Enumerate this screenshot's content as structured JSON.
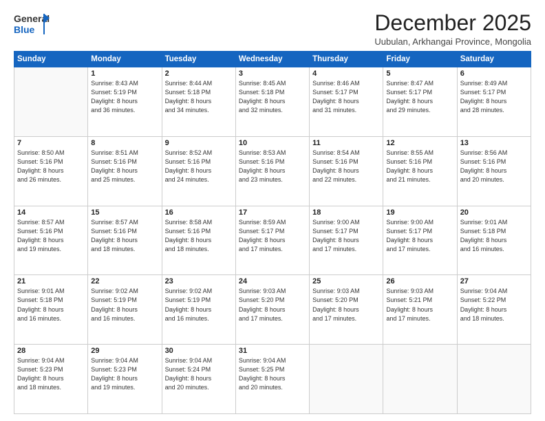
{
  "header": {
    "logo": {
      "line1": "General",
      "line2": "Blue"
    },
    "title": "December 2025",
    "location": "Uubulan, Arkhangai Province, Mongolia"
  },
  "weekdays": [
    "Sunday",
    "Monday",
    "Tuesday",
    "Wednesday",
    "Thursday",
    "Friday",
    "Saturday"
  ],
  "weeks": [
    [
      {
        "day": "",
        "info": ""
      },
      {
        "day": "1",
        "info": "Sunrise: 8:43 AM\nSunset: 5:19 PM\nDaylight: 8 hours\nand 36 minutes."
      },
      {
        "day": "2",
        "info": "Sunrise: 8:44 AM\nSunset: 5:18 PM\nDaylight: 8 hours\nand 34 minutes."
      },
      {
        "day": "3",
        "info": "Sunrise: 8:45 AM\nSunset: 5:18 PM\nDaylight: 8 hours\nand 32 minutes."
      },
      {
        "day": "4",
        "info": "Sunrise: 8:46 AM\nSunset: 5:17 PM\nDaylight: 8 hours\nand 31 minutes."
      },
      {
        "day": "5",
        "info": "Sunrise: 8:47 AM\nSunset: 5:17 PM\nDaylight: 8 hours\nand 29 minutes."
      },
      {
        "day": "6",
        "info": "Sunrise: 8:49 AM\nSunset: 5:17 PM\nDaylight: 8 hours\nand 28 minutes."
      }
    ],
    [
      {
        "day": "7",
        "info": "Sunrise: 8:50 AM\nSunset: 5:16 PM\nDaylight: 8 hours\nand 26 minutes."
      },
      {
        "day": "8",
        "info": "Sunrise: 8:51 AM\nSunset: 5:16 PM\nDaylight: 8 hours\nand 25 minutes."
      },
      {
        "day": "9",
        "info": "Sunrise: 8:52 AM\nSunset: 5:16 PM\nDaylight: 8 hours\nand 24 minutes."
      },
      {
        "day": "10",
        "info": "Sunrise: 8:53 AM\nSunset: 5:16 PM\nDaylight: 8 hours\nand 23 minutes."
      },
      {
        "day": "11",
        "info": "Sunrise: 8:54 AM\nSunset: 5:16 PM\nDaylight: 8 hours\nand 22 minutes."
      },
      {
        "day": "12",
        "info": "Sunrise: 8:55 AM\nSunset: 5:16 PM\nDaylight: 8 hours\nand 21 minutes."
      },
      {
        "day": "13",
        "info": "Sunrise: 8:56 AM\nSunset: 5:16 PM\nDaylight: 8 hours\nand 20 minutes."
      }
    ],
    [
      {
        "day": "14",
        "info": "Sunrise: 8:57 AM\nSunset: 5:16 PM\nDaylight: 8 hours\nand 19 minutes."
      },
      {
        "day": "15",
        "info": "Sunrise: 8:57 AM\nSunset: 5:16 PM\nDaylight: 8 hours\nand 18 minutes."
      },
      {
        "day": "16",
        "info": "Sunrise: 8:58 AM\nSunset: 5:16 PM\nDaylight: 8 hours\nand 18 minutes."
      },
      {
        "day": "17",
        "info": "Sunrise: 8:59 AM\nSunset: 5:17 PM\nDaylight: 8 hours\nand 17 minutes."
      },
      {
        "day": "18",
        "info": "Sunrise: 9:00 AM\nSunset: 5:17 PM\nDaylight: 8 hours\nand 17 minutes."
      },
      {
        "day": "19",
        "info": "Sunrise: 9:00 AM\nSunset: 5:17 PM\nDaylight: 8 hours\nand 17 minutes."
      },
      {
        "day": "20",
        "info": "Sunrise: 9:01 AM\nSunset: 5:18 PM\nDaylight: 8 hours\nand 16 minutes."
      }
    ],
    [
      {
        "day": "21",
        "info": "Sunrise: 9:01 AM\nSunset: 5:18 PM\nDaylight: 8 hours\nand 16 minutes."
      },
      {
        "day": "22",
        "info": "Sunrise: 9:02 AM\nSunset: 5:19 PM\nDaylight: 8 hours\nand 16 minutes."
      },
      {
        "day": "23",
        "info": "Sunrise: 9:02 AM\nSunset: 5:19 PM\nDaylight: 8 hours\nand 16 minutes."
      },
      {
        "day": "24",
        "info": "Sunrise: 9:03 AM\nSunset: 5:20 PM\nDaylight: 8 hours\nand 17 minutes."
      },
      {
        "day": "25",
        "info": "Sunrise: 9:03 AM\nSunset: 5:20 PM\nDaylight: 8 hours\nand 17 minutes."
      },
      {
        "day": "26",
        "info": "Sunrise: 9:03 AM\nSunset: 5:21 PM\nDaylight: 8 hours\nand 17 minutes."
      },
      {
        "day": "27",
        "info": "Sunrise: 9:04 AM\nSunset: 5:22 PM\nDaylight: 8 hours\nand 18 minutes."
      }
    ],
    [
      {
        "day": "28",
        "info": "Sunrise: 9:04 AM\nSunset: 5:23 PM\nDaylight: 8 hours\nand 18 minutes."
      },
      {
        "day": "29",
        "info": "Sunrise: 9:04 AM\nSunset: 5:23 PM\nDaylight: 8 hours\nand 19 minutes."
      },
      {
        "day": "30",
        "info": "Sunrise: 9:04 AM\nSunset: 5:24 PM\nDaylight: 8 hours\nand 20 minutes."
      },
      {
        "day": "31",
        "info": "Sunrise: 9:04 AM\nSunset: 5:25 PM\nDaylight: 8 hours\nand 20 minutes."
      },
      {
        "day": "",
        "info": ""
      },
      {
        "day": "",
        "info": ""
      },
      {
        "day": "",
        "info": ""
      }
    ]
  ]
}
